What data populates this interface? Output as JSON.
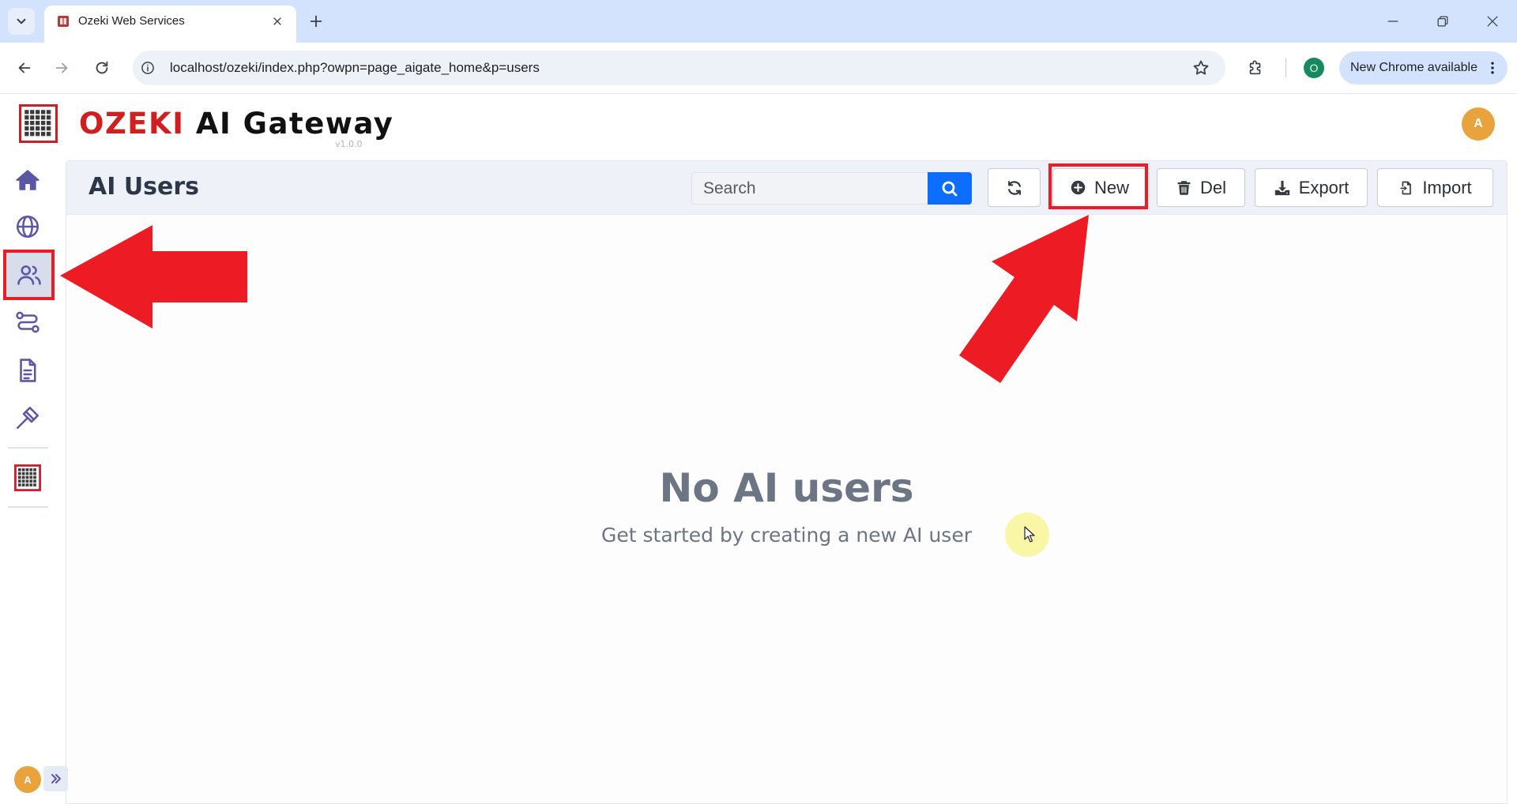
{
  "browser": {
    "tab_title": "Ozeki Web Services",
    "url": "localhost/ozeki/index.php?owpn=page_aigate_home&p=users",
    "profile_initial": "O",
    "update_label": "New Chrome available",
    "icons": [
      "chevron-down-icon",
      "favicon-icon",
      "close-icon",
      "plus-icon",
      "minimize-icon",
      "restore-icon",
      "window-close-icon",
      "back-arrow-icon",
      "forward-arrow-icon",
      "reload-icon",
      "info-icon",
      "star-icon",
      "puzzle-icon",
      "kebab-menu-icon"
    ]
  },
  "app": {
    "brand_primary": "OZEKI",
    "brand_secondary": "AI Gateway",
    "version": "v1.0.0",
    "user_initial": "A"
  },
  "sidebar": {
    "items": [
      {
        "icon": "home-icon",
        "active": false
      },
      {
        "icon": "globe-icon",
        "active": false
      },
      {
        "icon": "users-icon",
        "active": true
      },
      {
        "icon": "routes-icon",
        "active": false
      },
      {
        "icon": "document-icon",
        "active": false
      },
      {
        "icon": "hammer-icon",
        "active": false
      },
      {
        "icon": "ozeki-logo-icon",
        "active": false
      }
    ],
    "user_initial": "A",
    "expand_icon": "double-chevron-right-icon"
  },
  "panel": {
    "title": "AI Users",
    "search_placeholder": "Search",
    "toolbar": {
      "refresh_icon": "refresh-icon",
      "new_label": "New",
      "new_icon": "plus-circle-icon",
      "del_label": "Del",
      "del_icon": "trash-icon",
      "export_label": "Export",
      "export_icon": "download-icon",
      "import_label": "Import",
      "import_icon": "file-import-icon"
    }
  },
  "empty_state": {
    "title": "No AI users",
    "subtitle": "Get started by creating a new AI user"
  },
  "colors": {
    "chrome-strip": "#d3e3fd",
    "url-bg": "#edf1f8",
    "brand-red": "#d11f1f",
    "icon-purple": "#5b56a6",
    "accent-blue": "#0d6efd",
    "annotation-red": "#ed1c24",
    "avatar-orange": "#e8a33d",
    "profile-green": "#168a5f",
    "panel-header": "#eef2f8",
    "empty-text": "#6b7583"
  }
}
